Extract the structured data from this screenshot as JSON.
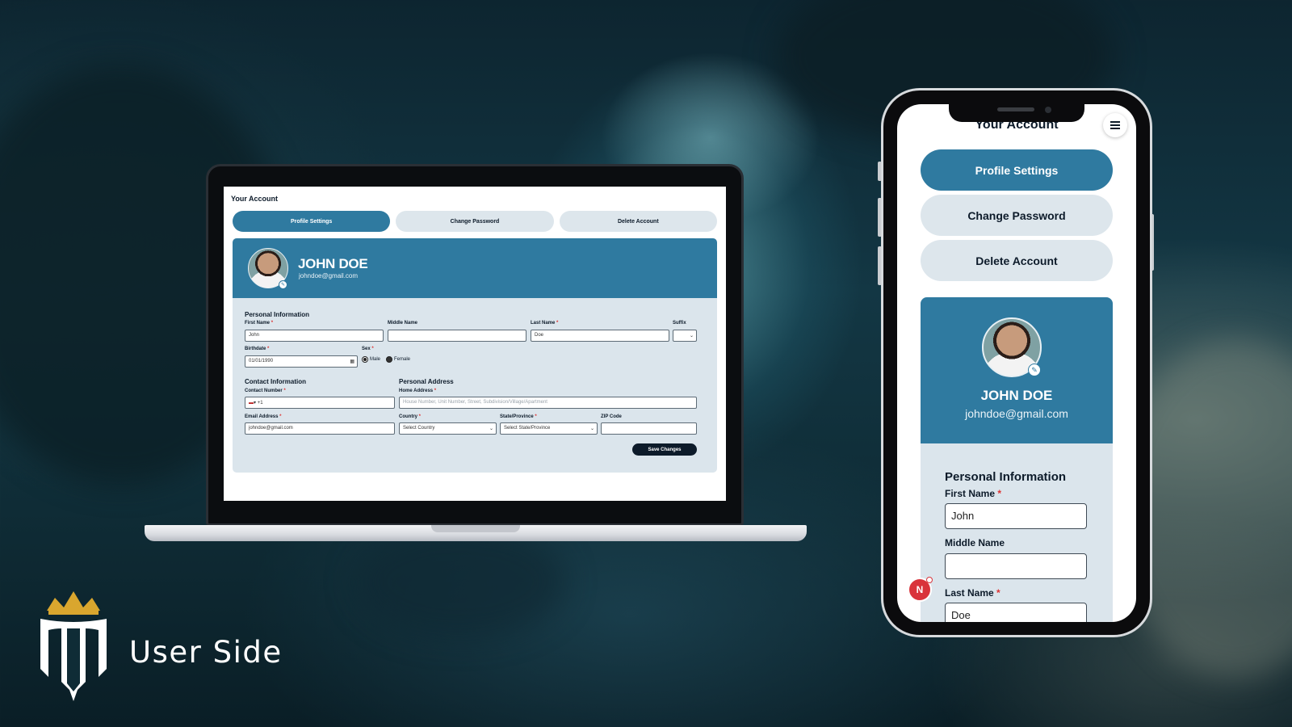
{
  "brand": {
    "caption": "User Side"
  },
  "laptop": {
    "page_title": "Your Account",
    "tabs": [
      {
        "label": "Profile Settings",
        "active": true
      },
      {
        "label": "Change Password",
        "active": false
      },
      {
        "label": "Delete Account",
        "active": false
      }
    ],
    "profile": {
      "name": "JOHN DOE",
      "email": "johndoe@gmail.com"
    },
    "personal_info": {
      "section_title": "Personal Information",
      "first_name": {
        "label": "First Name",
        "value": "John",
        "required": "*"
      },
      "middle_name": {
        "label": "Middle Name",
        "value": ""
      },
      "last_name": {
        "label": "Last Name",
        "value": "Doe",
        "required": "*"
      },
      "suffix": {
        "label": "Suffix",
        "value": ""
      },
      "birthdate": {
        "label": "Birthdate",
        "value": "01/01/1990",
        "required": "*"
      },
      "sex": {
        "label": "Sex",
        "required": "*",
        "options": [
          "Male",
          "Female"
        ],
        "selected": "Male"
      }
    },
    "contact_info": {
      "section_title": "Contact Information",
      "contact_number": {
        "label": "Contact Number",
        "required": "*",
        "prefix": "+1",
        "value": ""
      },
      "email_address": {
        "label": "Email Address",
        "required": "*",
        "value": "johndoe@gmail.com"
      }
    },
    "personal_address": {
      "section_title": "Personal Address",
      "home_address": {
        "label": "Home Address",
        "required": "*",
        "placeholder": "House Number, Unit Number, Street, Subdivision/Village/Apartment"
      },
      "country": {
        "label": "Country",
        "required": "*",
        "selected": "Select Country"
      },
      "state": {
        "label": "State/Province",
        "required": "*",
        "selected": "Select State/Province"
      },
      "zip": {
        "label": "ZIP Code",
        "value": ""
      }
    },
    "save_label": "Save Changes"
  },
  "phone": {
    "page_title": "Your Account",
    "tabs": [
      {
        "label": "Profile Settings",
        "active": true
      },
      {
        "label": "Change Password",
        "active": false
      },
      {
        "label": "Delete Account",
        "active": false
      }
    ],
    "profile": {
      "name": "JOHN DOE",
      "email": "johndoe@gmail.com"
    },
    "section_title": "Personal Information",
    "first_name": {
      "label": "First Name",
      "required": "*",
      "value": "John"
    },
    "middle_name": {
      "label": "Middle Name",
      "value": ""
    },
    "last_name": {
      "label": "Last Name",
      "required": "*",
      "value": "Doe"
    },
    "fab_letter": "N"
  },
  "colors": {
    "accent": "#2f7aa0",
    "dark": "#0d1b2a",
    "card": "#dbe5ec",
    "required": "#d33333",
    "brand_gold": "#d9a62e"
  }
}
